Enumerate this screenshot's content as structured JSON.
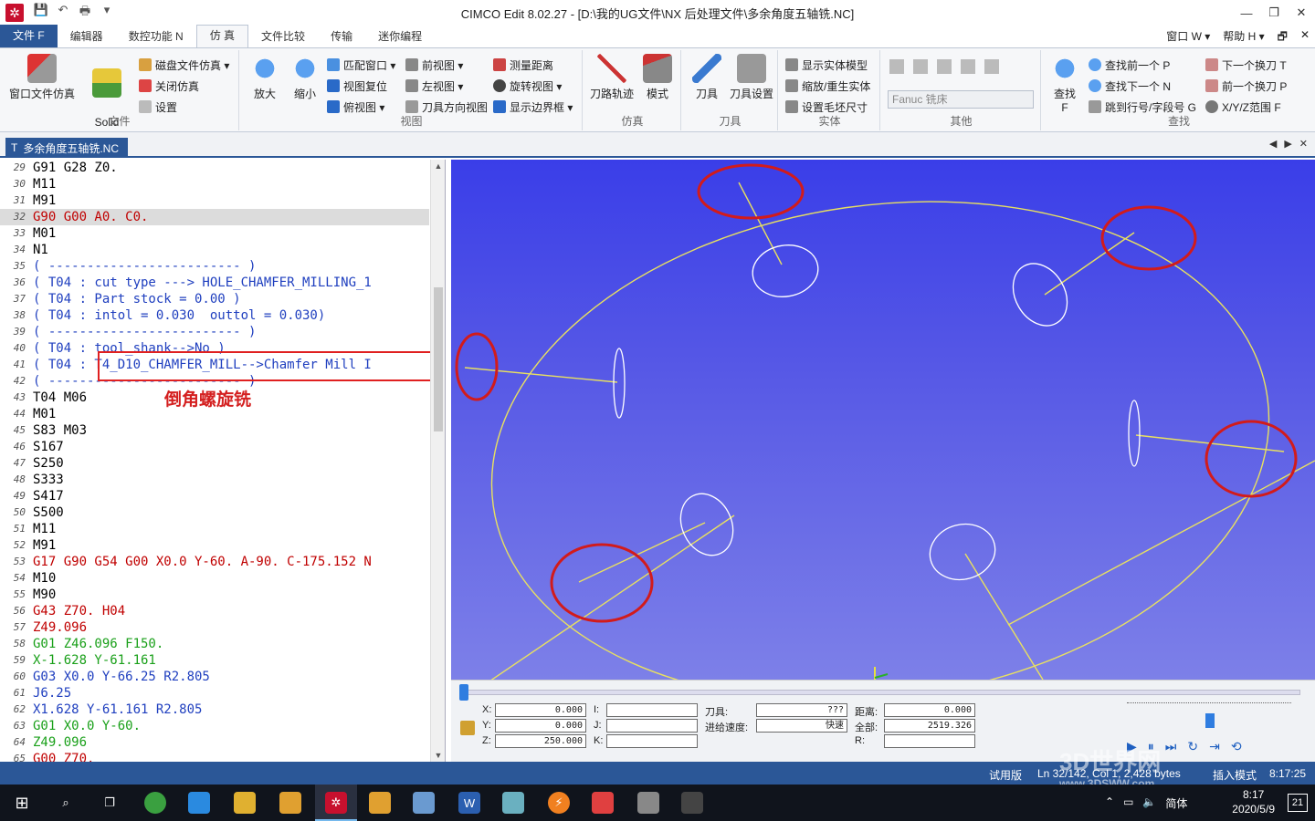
{
  "window": {
    "title": "CIMCO Edit 8.02.27 - [D:\\我的UG文件\\NX 后处理文件\\多余角度五轴铣.NC]",
    "quick_access": [
      "💾",
      "↶",
      "🖶",
      "▾"
    ]
  },
  "menu": {
    "tabs": [
      "文件 F",
      "编辑器",
      "数控功能 N",
      "仿 真",
      "文件比较",
      "传输",
      "迷你编程"
    ],
    "active_tab": "仿 真",
    "right_items": [
      "窗口 W ▾",
      "帮助 H ▾",
      "🗗",
      "✕"
    ]
  },
  "ribbon": {
    "groups": {
      "file": "文件",
      "view": "视图",
      "simulation": "仿真",
      "tool": "刀具",
      "solid": "实体",
      "other": "其他",
      "find": "查找"
    },
    "buttons": {
      "window_sim": "窗口文件仿真",
      "solid_anim": "Solid\nAnimation",
      "disk_sim": "磁盘文件仿真 ▾",
      "close_sim": "关闭仿真",
      "settings": "设置",
      "zoom_in": "放大",
      "zoom_out": "缩小",
      "fit_window": "匹配窗口 ▾",
      "view_reset": "视图复位",
      "top_view": "俯视图 ▾",
      "front_view": "前视图 ▾",
      "left_view": "左视图 ▾",
      "tool_dir_view": "刀具方向视图",
      "measure": "测量距离",
      "rotate_view": "旋转视图 ▾",
      "show_bbox": "显示边界框 ▾",
      "toolpath": "刀路轨迹",
      "mode": "模式",
      "tool": "刀具",
      "tool_setup": "刀具设置",
      "show_solid": "显示实体模型",
      "zoom_regen": "缩放/重生实体",
      "stock_size": "设置毛坯尺寸",
      "machine_combo": "Fanuc 铣床",
      "find": "查找",
      "find_key": "F",
      "find_prev": "查找前一个 P",
      "find_next": "查找下一个 N",
      "jump_line": "跳到行号/字段号 G",
      "next_tool": "下一个换刀 T",
      "prev_tool": "前一个换刀 P",
      "xyz_range": "X/Y/Z范围 F"
    }
  },
  "doc_tab": {
    "label": "多余角度五轴铣.NC",
    "controls": [
      "◀",
      "▶",
      "✕"
    ]
  },
  "editor": {
    "lines": [
      {
        "n": "29",
        "t": "G91 G28 Z0.",
        "c": "#000000"
      },
      {
        "n": "30",
        "t": "M11",
        "c": "#000000"
      },
      {
        "n": "31",
        "t": "M91",
        "c": "#000000"
      },
      {
        "n": "32",
        "t": "G90 G00 A0. C0.",
        "c": "#c00000"
      },
      {
        "n": "33",
        "t": "M01",
        "c": "#000000"
      },
      {
        "n": "34",
        "t": "N1",
        "c": "#000000"
      },
      {
        "n": "35",
        "t": "( ------------------------- )",
        "c": "#1f3fbf"
      },
      {
        "n": "36",
        "t": "( T04 : cut type ---> HOLE_CHAMFER_MILLING_1",
        "c": "#1f3fbf"
      },
      {
        "n": "37",
        "t": "( T04 : Part stock = 0.00 )",
        "c": "#1f3fbf"
      },
      {
        "n": "38",
        "t": "( T04 : intol = 0.030  outtol = 0.030)",
        "c": "#1f3fbf"
      },
      {
        "n": "39",
        "t": "( ------------------------- )",
        "c": "#1f3fbf"
      },
      {
        "n": "40",
        "t": "( T04 : tool_shank-->No )",
        "c": "#1f3fbf"
      },
      {
        "n": "41",
        "t": "( T04 : T4_D10_CHAMFER_MILL-->Chamfer Mill I",
        "c": "#1f3fbf"
      },
      {
        "n": "42",
        "t": "( ------------------------- )",
        "c": "#1f3fbf"
      },
      {
        "n": "43",
        "t": "T04 M06",
        "c": "#000000"
      },
      {
        "n": "44",
        "t": "M01",
        "c": "#000000"
      },
      {
        "n": "45",
        "t": "S83 M03",
        "c": "#000000"
      },
      {
        "n": "46",
        "t": "S167",
        "c": "#000000"
      },
      {
        "n": "47",
        "t": "S250",
        "c": "#000000"
      },
      {
        "n": "48",
        "t": "S333",
        "c": "#000000"
      },
      {
        "n": "49",
        "t": "S417",
        "c": "#000000"
      },
      {
        "n": "50",
        "t": "S500",
        "c": "#000000"
      },
      {
        "n": "51",
        "t": "M11",
        "c": "#000000"
      },
      {
        "n": "52",
        "t": "M91",
        "c": "#000000"
      },
      {
        "n": "53",
        "t": "G17 G90 G54 G00 X0.0 Y-60. A-90. C-175.152 N",
        "c": "#c00000"
      },
      {
        "n": "54",
        "t": "M10",
        "c": "#000000"
      },
      {
        "n": "55",
        "t": "M90",
        "c": "#000000"
      },
      {
        "n": "56",
        "t": "G43 Z70. H04",
        "c": "#c00000"
      },
      {
        "n": "57",
        "t": "Z49.096",
        "c": "#c00000"
      },
      {
        "n": "58",
        "t": "G01 Z46.096 F150.",
        "c": "#1aa01a"
      },
      {
        "n": "59",
        "t": "X-1.628 Y-61.161",
        "c": "#1aa01a"
      },
      {
        "n": "60",
        "t": "G03 X0.0 Y-66.25 R2.805",
        "c": "#1f3fbf"
      },
      {
        "n": "61",
        "t": "J6.25",
        "c": "#1f3fbf"
      },
      {
        "n": "62",
        "t": "X1.628 Y-61.161 R2.805",
        "c": "#1f3fbf"
      },
      {
        "n": "63",
        "t": "G01 X0.0 Y-60.",
        "c": "#1aa01a"
      },
      {
        "n": "64",
        "t": "Z49.096",
        "c": "#1aa01a"
      },
      {
        "n": "65",
        "t": "G00 Z70.",
        "c": "#c00000"
      }
    ],
    "current_line": "32",
    "annotation": "倒角螺旋铣"
  },
  "panel": {
    "labels": {
      "x": "X:",
      "y": "Y:",
      "z": "Z:",
      "i": "I:",
      "j": "J:",
      "k": "K:",
      "tool": "刀具:",
      "feed": "进给速度:",
      "dist": "距离:",
      "total": "全部:",
      "r": "R:"
    },
    "values": {
      "x": "0.000",
      "y": "0.000",
      "z": "250.000",
      "i": "",
      "j": "",
      "k": "",
      "tool": "???",
      "feed": "快速",
      "dist": "0.000",
      "total": "2519.326",
      "r": ""
    },
    "play_controls": [
      "▶",
      "⏸",
      "⏭",
      "↻",
      "⇥",
      "⟲"
    ],
    "progress": 0.0,
    "speed": 0.48
  },
  "status": {
    "mode": "试用版",
    "position": "Ln 32/142, Col 1, 2,428 bytes",
    "insert": "插入模式",
    "time": "8:17:25"
  },
  "taskbar": {
    "clock_time": "8:17",
    "clock_date": "2020/5/9",
    "ime": "简体",
    "notif_count": "21"
  },
  "watermark": {
    "big": "3D世界网",
    "small": "www.3DSWW.com"
  },
  "colors": {
    "accent": "#2b5797",
    "viewport_top": "#3a3ee8",
    "toolpath": "#e8e060",
    "highlight": "#e02020"
  }
}
